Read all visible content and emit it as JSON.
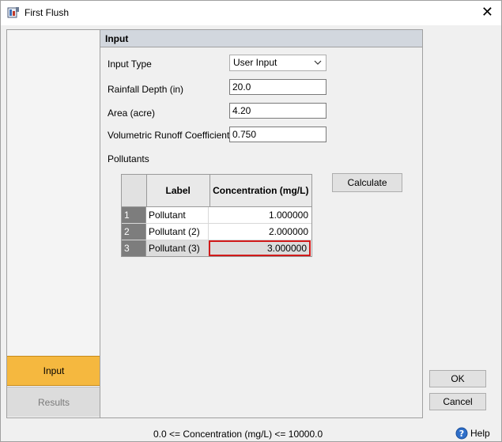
{
  "window": {
    "title": "First Flush",
    "close_glyph": "✕"
  },
  "nav": {
    "input_label": "Input",
    "results_label": "Results"
  },
  "section": {
    "title": "Input"
  },
  "form": {
    "input_type_label": "Input Type",
    "input_type_value": "User Input",
    "rainfall_label": "Rainfall Depth (in)",
    "rainfall_value": "20.0",
    "area_label": "Area (acre)",
    "area_value": "4.20",
    "runoff_label": "Volumetric Runoff Coefficient",
    "runoff_value": "0.750",
    "pollutants_label": "Pollutants"
  },
  "table": {
    "columns": [
      "Label",
      "Concentration (mg/L)"
    ],
    "rows": [
      {
        "num": "1",
        "label": "Pollutant",
        "conc": "1.000000"
      },
      {
        "num": "2",
        "label": "Pollutant (2)",
        "conc": "2.000000"
      },
      {
        "num": "3",
        "label": "Pollutant (3)",
        "conc": "3.000000"
      }
    ]
  },
  "buttons": {
    "calculate": "Calculate",
    "ok": "OK",
    "cancel": "Cancel",
    "help": "Help"
  },
  "status": {
    "text": "0.0 <= Concentration (mg/L) <= 10000.0"
  },
  "colors": {
    "accent": "#f5b83f",
    "focus_border": "#d11a1a",
    "header_band": "#d2d7de"
  }
}
